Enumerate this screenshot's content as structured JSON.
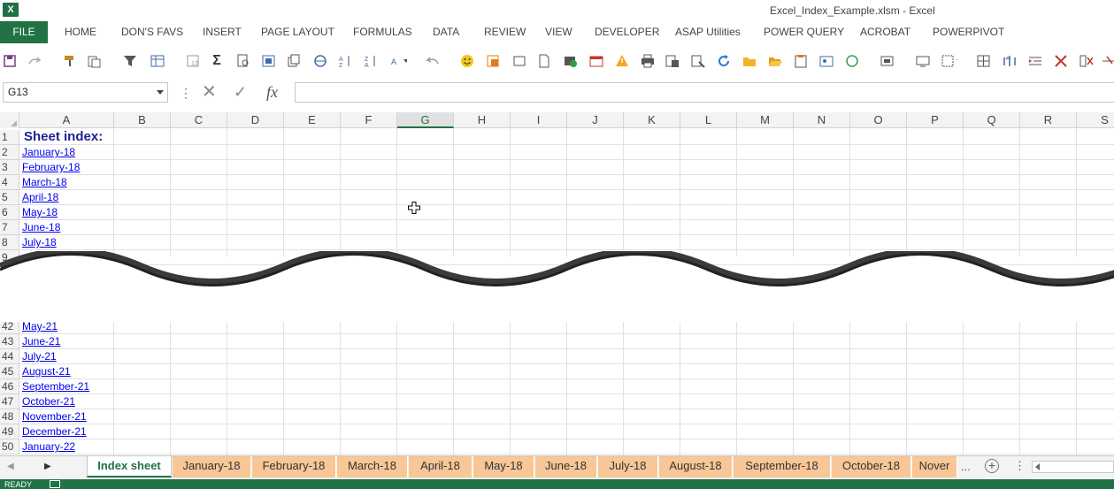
{
  "window": {
    "app_icon": "X",
    "title": "Excel_Index_Example.xlsm - Excel"
  },
  "ribbon": {
    "file_tab": "FILE",
    "tabs": [
      "HOME",
      "DON'S FAVS",
      "INSERT",
      "PAGE LAYOUT",
      "FORMULAS",
      "DATA",
      "REVIEW",
      "VIEW",
      "DEVELOPER",
      "ASAP Utilities",
      "POWER QUERY",
      "ACROBAT",
      "POWERPIVOT"
    ]
  },
  "formula_bar": {
    "name_box": "G13",
    "cancel_symbol": "✕",
    "enter_symbol": "✓",
    "fx_label": "fx",
    "separator": "⋮",
    "formula": ""
  },
  "grid": {
    "columns": [
      "A",
      "B",
      "C",
      "D",
      "E",
      "F",
      "G",
      "H",
      "I",
      "J",
      "K",
      "L",
      "M",
      "N",
      "O",
      "P",
      "Q",
      "R",
      "S"
    ],
    "selected_column": "G",
    "title_cell": "Sheet index:",
    "top_rows": [
      {
        "row": "1",
        "value": ""
      },
      {
        "row": "2",
        "value": "January-18"
      },
      {
        "row": "3",
        "value": "February-18"
      },
      {
        "row": "4",
        "value": "March-18"
      },
      {
        "row": "5",
        "value": "April-18"
      },
      {
        "row": "6",
        "value": "May-18"
      },
      {
        "row": "7",
        "value": "June-18"
      },
      {
        "row": "8",
        "value": "July-18"
      },
      {
        "row": "9",
        "value": ""
      }
    ],
    "bottom_rows": [
      {
        "row": "42",
        "value": "May-21"
      },
      {
        "row": "43",
        "value": "June-21"
      },
      {
        "row": "44",
        "value": "July-21"
      },
      {
        "row": "45",
        "value": "August-21"
      },
      {
        "row": "46",
        "value": "September-21"
      },
      {
        "row": "47",
        "value": "October-21"
      },
      {
        "row": "48",
        "value": "November-21"
      },
      {
        "row": "49",
        "value": "December-21"
      },
      {
        "row": "50",
        "value": "January-22"
      }
    ]
  },
  "sheet_tabs": {
    "tabs": [
      "Index sheet",
      "January-18",
      "February-18",
      "March-18",
      "April-18",
      "May-18",
      "June-18",
      "July-18",
      "August-18",
      "September-18",
      "October-18",
      "Nover"
    ],
    "active": "Index sheet",
    "more_label": "...",
    "add_symbol": "+",
    "options_symbol": "⋮",
    "tab_color": "#f8c697"
  },
  "status_bar": {
    "text": "READY"
  },
  "colors": {
    "excel_green": "#217346",
    "hyperlink": "#0000ee",
    "title_text": "#1f1f8f"
  }
}
